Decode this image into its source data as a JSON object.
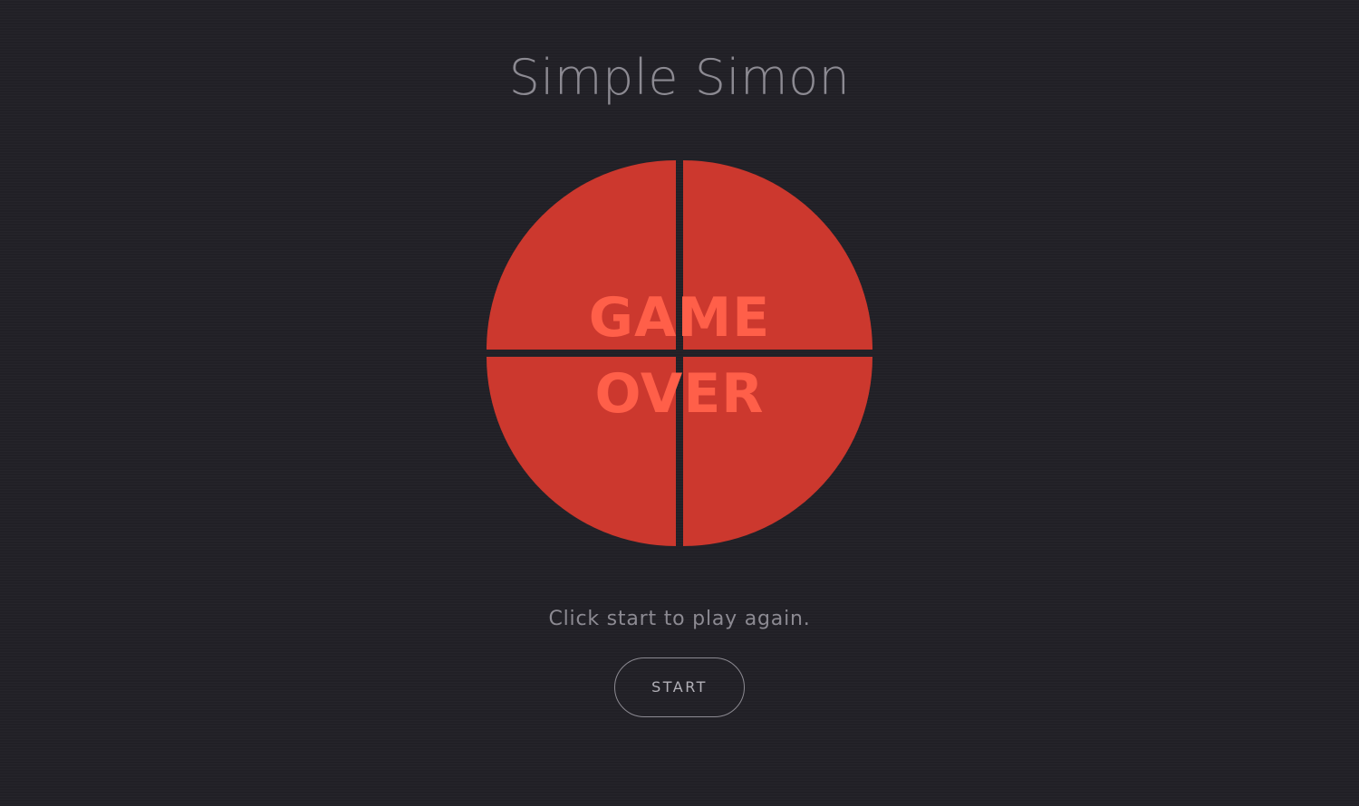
{
  "header": {
    "title": "Simple Simon"
  },
  "board": {
    "overlay_line1": "GAME",
    "overlay_line2": "OVER",
    "quadrant_color": "#cc382e",
    "overlay_color": "#ff5f49"
  },
  "status": {
    "message": "Click start to play again."
  },
  "controls": {
    "start_label": "START"
  },
  "theme": {
    "background": "#212026",
    "text_muted": "#8c8a92"
  }
}
